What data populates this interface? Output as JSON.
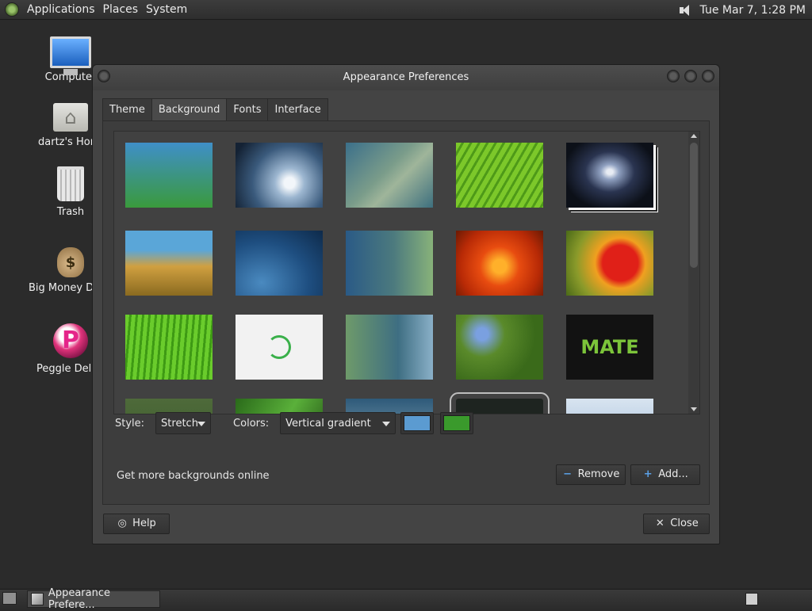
{
  "top_panel": {
    "menus": [
      "Applications",
      "Places",
      "System"
    ],
    "clock": "Tue Mar  7,  1:28 PM",
    "logo_icon": "mate-menu-icon",
    "volume_icon": "speaker-icon"
  },
  "desktop_icons": [
    {
      "label": "Computer",
      "icon": "computer-icon"
    },
    {
      "label": "dartz's Home",
      "icon": "home-folder-icon"
    },
    {
      "label": "Trash",
      "icon": "trash-icon"
    },
    {
      "label": "Big Money Deluxe",
      "icon": "money-bag-icon"
    },
    {
      "label": "Peggle Deluxe",
      "icon": "peggle-icon"
    }
  ],
  "dialog": {
    "title": "Appearance Preferences",
    "tabs": [
      "Theme",
      "Background",
      "Fonts",
      "Interface"
    ],
    "active_tab": "Background",
    "style_label": "Style:",
    "style_value": "Stretch",
    "colors_label": "Colors:",
    "colors_value": "Vertical gradient",
    "primary_color": "#5b9bd1",
    "secondary_color": "#3a9a2c",
    "online_link": "Get more backgrounds online",
    "remove_label": "Remove",
    "add_label": "Add...",
    "help_label": "Help",
    "close_label": "Close",
    "mate_logo_text": "MATE"
  },
  "taskbar": {
    "window_button": "Appearance Prefere..."
  }
}
